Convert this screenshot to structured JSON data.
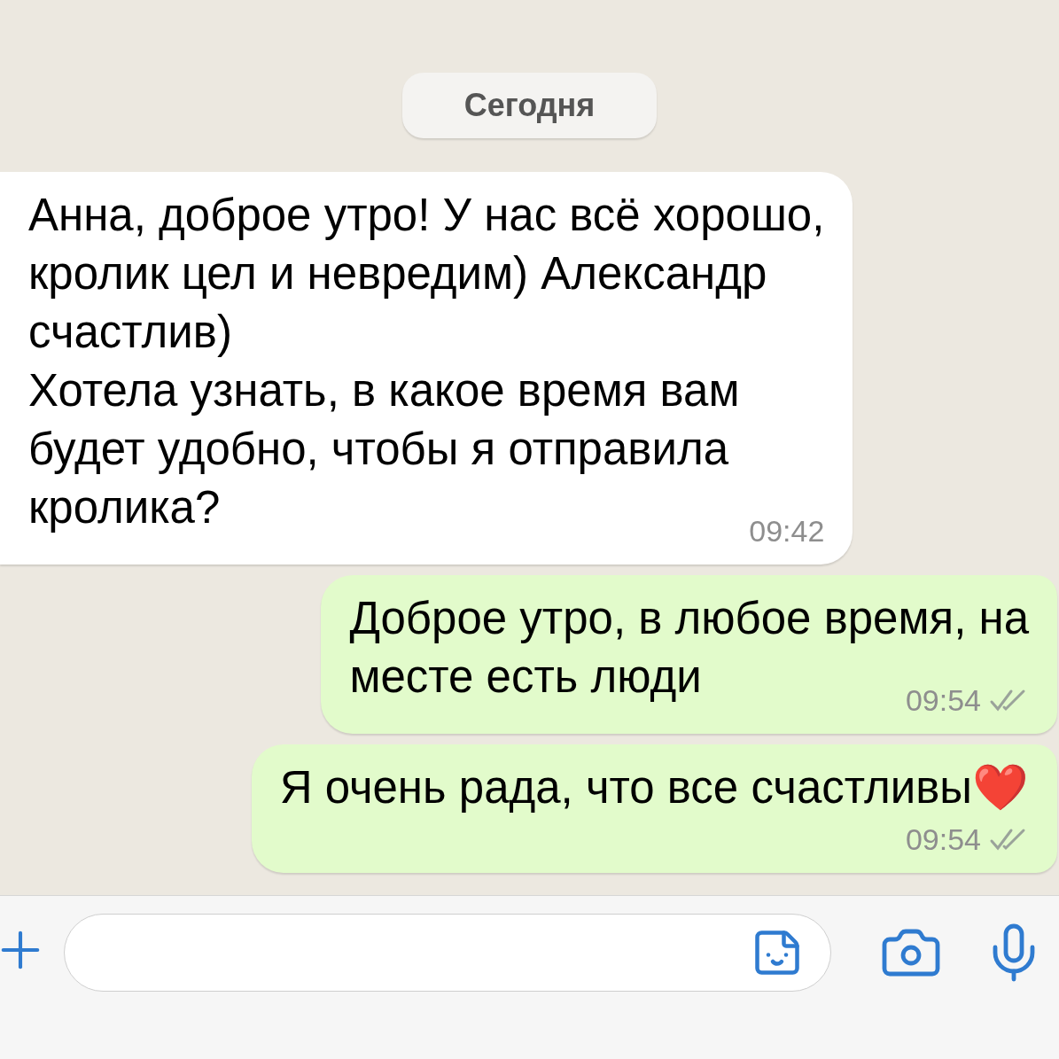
{
  "date_label": "Сегодня",
  "messages": [
    {
      "kind": "incoming",
      "lines": [
        "Анна, доброе утро! У нас всё хорошо,",
        "кролик цел и невредим) Александр",
        "счастлив)",
        "Хотела узнать, в какое время вам",
        "будет удобно, чтобы я отправила",
        "кролика?"
      ],
      "time": "09:42"
    },
    {
      "kind": "outgoing",
      "lines": [
        "Доброе утро, в любое время, на",
        "месте есть люди"
      ],
      "time": "09:54",
      "read": false
    },
    {
      "kind": "outgoing",
      "lines": [
        "Я очень рада, что все счастливы❤️"
      ],
      "time": "09:54",
      "read": false
    }
  ]
}
